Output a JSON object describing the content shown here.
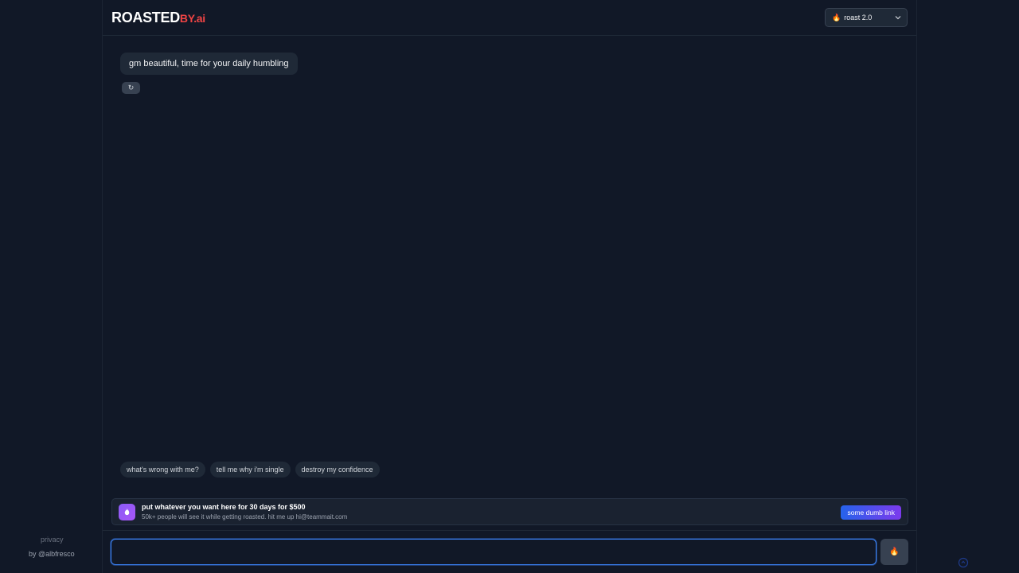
{
  "header": {
    "logo_main": "ROASTED",
    "logo_accent": "BY.ai",
    "model_select": {
      "selected": "roast 2.0",
      "icon": "flame-icon"
    }
  },
  "chat": {
    "messages": [
      {
        "role": "assistant",
        "text": "gm beautiful, time for your daily humbling"
      }
    ],
    "refresh_label": "↻"
  },
  "suggestions": [
    {
      "label": "what's wrong with me?"
    },
    {
      "label": "tell me why i'm single"
    },
    {
      "label": "destroy my confidence"
    }
  ],
  "ad": {
    "icon": "flame-icon",
    "title": "put whatever you want here for 30 days for $500",
    "subtitle": "50k+ people will see it while getting roasted. hit me up hi@teammait.com",
    "button": "some dumb link"
  },
  "composer": {
    "value": "",
    "send_icon": "flame-icon"
  },
  "sidebar_footer": {
    "privacy": "privacy",
    "credit": "by @albfresco"
  },
  "colors": {
    "background": "#111827",
    "accent_red": "#ef4444",
    "focus_blue": "#3b82f6",
    "ad_gradient_start": "#2563eb",
    "ad_gradient_end": "#7c3aed"
  }
}
